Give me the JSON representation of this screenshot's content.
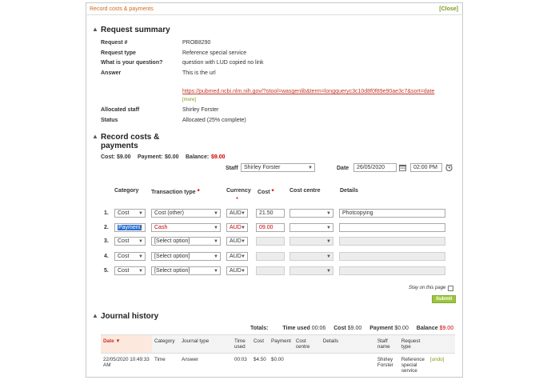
{
  "topbar": {
    "title": "Record costs & payments",
    "close": "[Close]"
  },
  "summary": {
    "heading": "Request summary",
    "fields": [
      {
        "label": "Request #",
        "value": "PROB8290"
      },
      {
        "label": "Request type",
        "value": "Reference special service"
      },
      {
        "label": "What is your question?",
        "value": "question with LUD copied no link"
      },
      {
        "label": "Answer",
        "value": "This is the url"
      }
    ],
    "answer_link": "https://pubmed.ncbi.nlm.nih.gov/?otool=wasgenlib&term=longqueryc3c10d8f0f89e90ae3c7&sort=date",
    "more": "[more]",
    "allocated_label": "Allocated staff",
    "allocated_value": "Shirley Forster",
    "status_label": "Status",
    "status_value": "Allocated (25% complete)"
  },
  "record": {
    "heading_line1": "Record costs &",
    "heading_line2": "payments",
    "cost_label": "Cost:",
    "cost_value": "$9.00",
    "payment_label": "Payment:",
    "payment_value": "$0.00",
    "balance_label": "Balance:",
    "balance_value": "$9.00",
    "staff_label": "Staff",
    "staff_value": "Shirley Forster",
    "date_label": "Date",
    "date_value": "26/05/2020",
    "time_value": "02:00 PM",
    "headers": {
      "category": "Category",
      "transaction_type": "Transaction type",
      "currency": "Currency",
      "cost": "Cost",
      "cost_centre": "Cost centre",
      "details": "Details"
    },
    "rows": [
      {
        "num": "1.",
        "category": "Cost",
        "type": "Cost (other)",
        "currency": "AUD",
        "cost": "21.50",
        "centre": "",
        "details": "Photcopying"
      },
      {
        "num": "2.",
        "category": "Payment",
        "type": "Cash",
        "currency": "AUD",
        "cost": "09.00",
        "centre": "",
        "details": ""
      },
      {
        "num": "3.",
        "category": "Cost",
        "type": "[Select option]",
        "currency": "AUD",
        "cost": "",
        "centre": "",
        "details": ""
      },
      {
        "num": "4.",
        "category": "Cost",
        "type": "[Select option]",
        "currency": "AUD",
        "cost": "",
        "centre": "",
        "details": ""
      },
      {
        "num": "5.",
        "category": "Cost",
        "type": "[Select option]",
        "currency": "AUD",
        "cost": "",
        "centre": "",
        "details": ""
      }
    ],
    "stay_label": "Stay on this page",
    "submit": "Submit"
  },
  "journal": {
    "heading": "Journal history",
    "totals_label": "Totals:",
    "time_used_label": "Time used",
    "time_used_value": "00:06",
    "cost_label": "Cost",
    "cost_value": "$9.00",
    "payment_label": "Payment",
    "payment_value": "$0.00",
    "balance_label": "Balance",
    "balance_value": "$9.00",
    "columns": [
      "Date",
      "Category",
      "Journal type",
      "Time used",
      "Cost",
      "Payment",
      "Cost centre",
      "Details",
      "Staff name",
      "Request type"
    ],
    "sort_arrow": "▼",
    "rows": [
      {
        "date": "22/05/2020 10:49:33 AM",
        "category": "Time",
        "journal_type": "Answer",
        "time_used": "00:03",
        "cost": "$4.50",
        "payment": "$0.00",
        "centre": "",
        "details": "",
        "staff": "Shirley Forster",
        "request_type": "Reference special service",
        "undo": "[undo]"
      }
    ]
  },
  "colors": {
    "accent_orange": "#d0691b",
    "accent_green": "#7a9a1a",
    "error_red": "#cc0000"
  }
}
